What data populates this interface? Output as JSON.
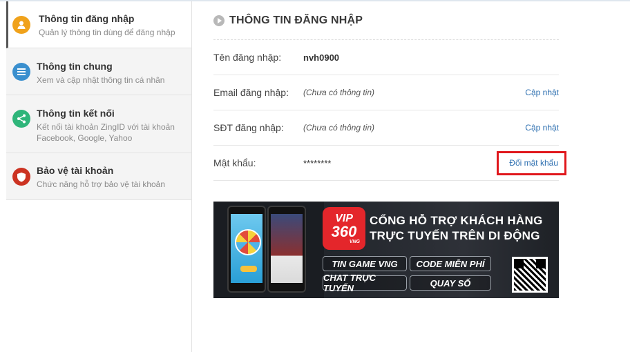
{
  "sidebar": {
    "items": [
      {
        "title": "Thông tin đăng nhập",
        "desc": "Quản lý thông tin dùng để đăng nhập",
        "icon": "user-icon",
        "active": true
      },
      {
        "title": "Thông tin chung",
        "desc": "Xem và cập nhật thông tin cá nhân",
        "icon": "menu-icon"
      },
      {
        "title": "Thông tin kết nối",
        "desc": "Kết nối tài khoản ZingID với tài khoản Facebook, Google, Yahoo",
        "icon": "share-icon"
      },
      {
        "title": "Bảo vệ tài khoản",
        "desc": "Chức năng hỗ trợ bảo vệ tài khoản",
        "icon": "shield-icon"
      }
    ]
  },
  "main": {
    "title": "THÔNG TIN ĐĂNG NHẬP",
    "rows": [
      {
        "label": "Tên đăng nhập:",
        "value": "nvh0900",
        "action": ""
      },
      {
        "label": "Email đăng nhập:",
        "value": "(Chưa có thông tin)",
        "action": "Cập nhật"
      },
      {
        "label": "SĐT đăng nhập:",
        "value": "(Chưa có thông tin)",
        "action": "Cập nhật"
      },
      {
        "label": "Mật khẩu:",
        "value": "********",
        "action": "Đổi mật khẩu"
      }
    ]
  },
  "banner": {
    "logo_line1": "VIP",
    "logo_line2": "360",
    "logo_line3": "VNG",
    "headline_1": "CỔNG HỖ TRỢ KHÁCH HÀNG",
    "headline_2": "TRỰC TUYẾN TRÊN DI ĐỘNG",
    "buttons": [
      "TIN GAME VNG",
      "CODE MIỄN PHÍ",
      "CHAT TRỰC TUYẾN",
      "QUAY SỐ"
    ]
  },
  "colors": {
    "highlight_box": "#e0171c",
    "link": "#2d6fb0",
    "brand_red": "#e4262b"
  }
}
